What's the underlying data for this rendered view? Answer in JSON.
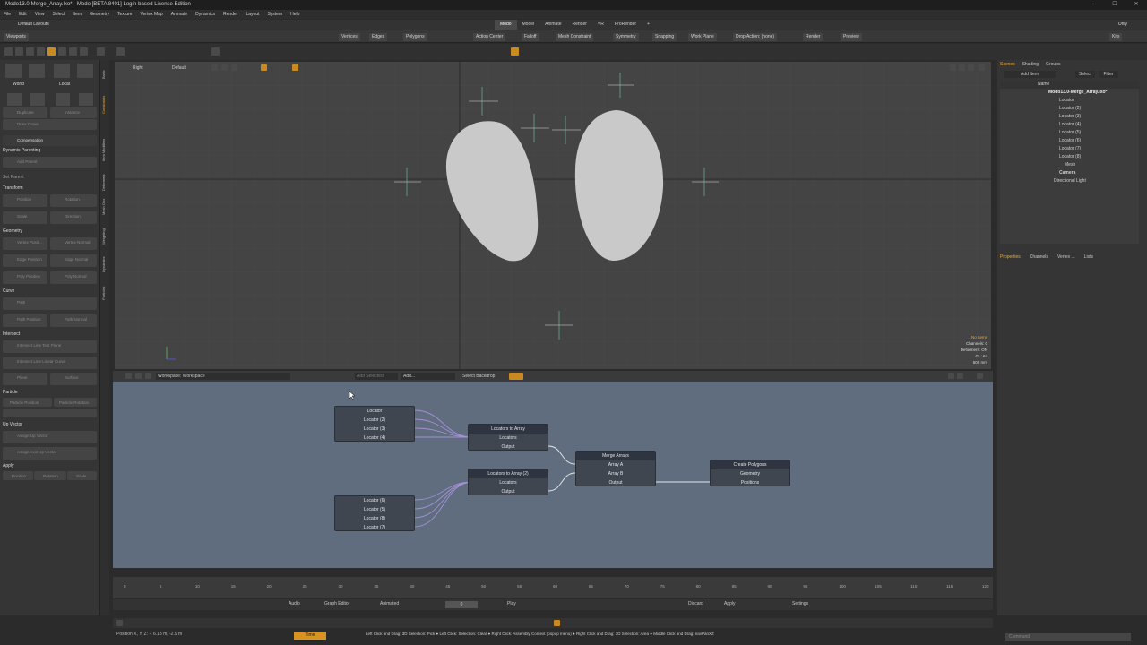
{
  "window": {
    "title": "Modo13.0-Merge_Array.lxo* - Modo [BETA 8401] Login-based License Edition"
  },
  "window_controls": [
    "—",
    "☐",
    "✕"
  ],
  "menu": [
    "File",
    "Edit",
    "View",
    "Select",
    "Item",
    "Geometry",
    "Texture",
    "Vertex Map",
    "Animate",
    "Dynamics",
    "Render",
    "Layout",
    "System",
    "Help"
  ],
  "layout": {
    "name": "Default Layouts",
    "only": "Only"
  },
  "mode_tabs": [
    {
      "label": "Modo",
      "active": true
    },
    {
      "label": "Model",
      "active": false
    },
    {
      "label": "Animate",
      "active": false
    },
    {
      "label": "Render",
      "active": false
    },
    {
      "label": "VR",
      "active": false
    },
    {
      "label": "ProRender",
      "active": false
    },
    {
      "label": "+",
      "active": false
    }
  ],
  "toolbar": {
    "viewports": "Viewports",
    "vertices": "Vertices",
    "edges": "Edges",
    "polygons": "Polygons",
    "action_center": "Action Center",
    "falloff": "Falloff",
    "mesh_constraint": "Mesh Constraint",
    "symmetry": "Symmetry",
    "snapping": "Snapping",
    "work_plane": "Work Plane",
    "drop_action": "Drop Action: (none)",
    "render": "Render",
    "preview": "Preview",
    "kits": "Kits"
  },
  "left_panel": {
    "world": "World",
    "local": "Local",
    "duplicate": "Duplicate",
    "instance": "Instance",
    "draw_curve": "Draw Curve",
    "compensation": "Compensation",
    "dynamic_parenting": "Dynamic Parenting",
    "add_parent": "Add Parent",
    "set_parent": "Set Parent",
    "transform": "Transform",
    "position": "Position",
    "rotation": "Rotation",
    "scale": "Scale",
    "direction": "Direction",
    "geometry": "Geometry",
    "vertex_position": "Vertex Posit...",
    "vertex_normal": "Vertex Normal",
    "edge_position": "Edge Position",
    "edge_normal": "Edge Normal",
    "poly_position": "Poly Position",
    "poly_normal": "Poly Normal",
    "curve": "Curve",
    "path": "Path",
    "path_position": "Path Position",
    "path_normal": "Path Normal",
    "intersect": "Intersect",
    "intersect_line_surf": "Intersect Line Test Plane",
    "intersect_line_curve": "Intersect Line Linear Curve",
    "plane": "Plane",
    "surface": "Surface",
    "particle": "Particle",
    "particle_position": "Particle Position",
    "particle_rotation": "Particle Rotation",
    "up_vector": "Up Vector",
    "assign_up_vector": "Assign Up Vector",
    "assign_axis_up_vector": "Assign Axis Up Vector",
    "apply": "Apply",
    "apply_position": "Position",
    "apply_rotation": "Rotation",
    "apply_scale": "Scale"
  },
  "vertical_tabs": [
    "Basic",
    "Constraints",
    "Item Modifiers",
    "Deformers",
    "Mesh Ops",
    "Weighting",
    "Dynamics",
    "Particles",
    "Scripts"
  ],
  "viewport": {
    "view_name": "Right",
    "shading": "Default",
    "info": [
      "No Items",
      "Channels: 0",
      "Deformers: ON",
      "GL: 64",
      "500 mm"
    ]
  },
  "node_editor": {
    "workspace": "Workspace: Workspace",
    "add_selected": "Add Selected",
    "add": "Add...",
    "select_backdrop": "Select Backdrop",
    "group1": [
      "Locator",
      "Locator (2)",
      "Locator (3)",
      "Locator (4)"
    ],
    "group2": [
      "Locator (6)",
      "Locator (5)",
      "Locator (8)",
      "Locator (7)"
    ],
    "loc_to_array_1": {
      "title": "Locators to Array",
      "in": "Locators",
      "out": "Output"
    },
    "loc_to_array_2": {
      "title": "Locators to Array (2)",
      "in": "Locators",
      "out": "Output"
    },
    "merge_arrays": {
      "title": "Merge Arrays",
      "a": "Array A",
      "b": "Array B",
      "out": "Output"
    },
    "create_polygons": {
      "title": "Create Polygons",
      "geo": "Geometry",
      "pos": "Positions"
    }
  },
  "scene_panel": {
    "tabs": [
      "Scenes",
      "Shading",
      "Groups"
    ],
    "add_item": "Add Item",
    "select": "Select",
    "filter": "Filter",
    "col_name": "Name",
    "root": "Modo13.0-Merge_Array.lxo*",
    "items": [
      "Locator",
      "Locator (2)",
      "Locator (3)",
      "Locator (4)",
      "Locator (5)",
      "Locator (6)",
      "Locator (7)",
      "Locator (8)",
      "Mesh",
      "Camera",
      "Directional Light"
    ]
  },
  "props_tabs": [
    "Properties",
    "Channels",
    "Vertex ...",
    "Lists"
  ],
  "timeline": {
    "ticks": [
      "0",
      "5",
      "10",
      "15",
      "20",
      "25",
      "30",
      "35",
      "40",
      "45",
      "50",
      "55",
      "60",
      "65",
      "70",
      "75",
      "80",
      "85",
      "90",
      "95",
      "100",
      "105",
      "110",
      "115",
      "120"
    ]
  },
  "transport": {
    "audio": "Audio",
    "graph_editor": "Graph Editor",
    "animated": "Animated",
    "frame": "0",
    "play": "Play",
    "discard": "Discard",
    "apply": "Apply",
    "settings": "Settings"
  },
  "status": {
    "position": "Position X, Y, Z:   -, 6.18 m, -2.9 m",
    "time_tab": "Time",
    "hint": "Left Click and Drag: 3D Selection: Pick ● Left Click: Selection: Clear ● Right Click: Assembly Context (popup menu) ● Right Click and Drag: 3D Selection: Area ● Middle Click and Drag: navPanXZ",
    "command": "Command"
  }
}
